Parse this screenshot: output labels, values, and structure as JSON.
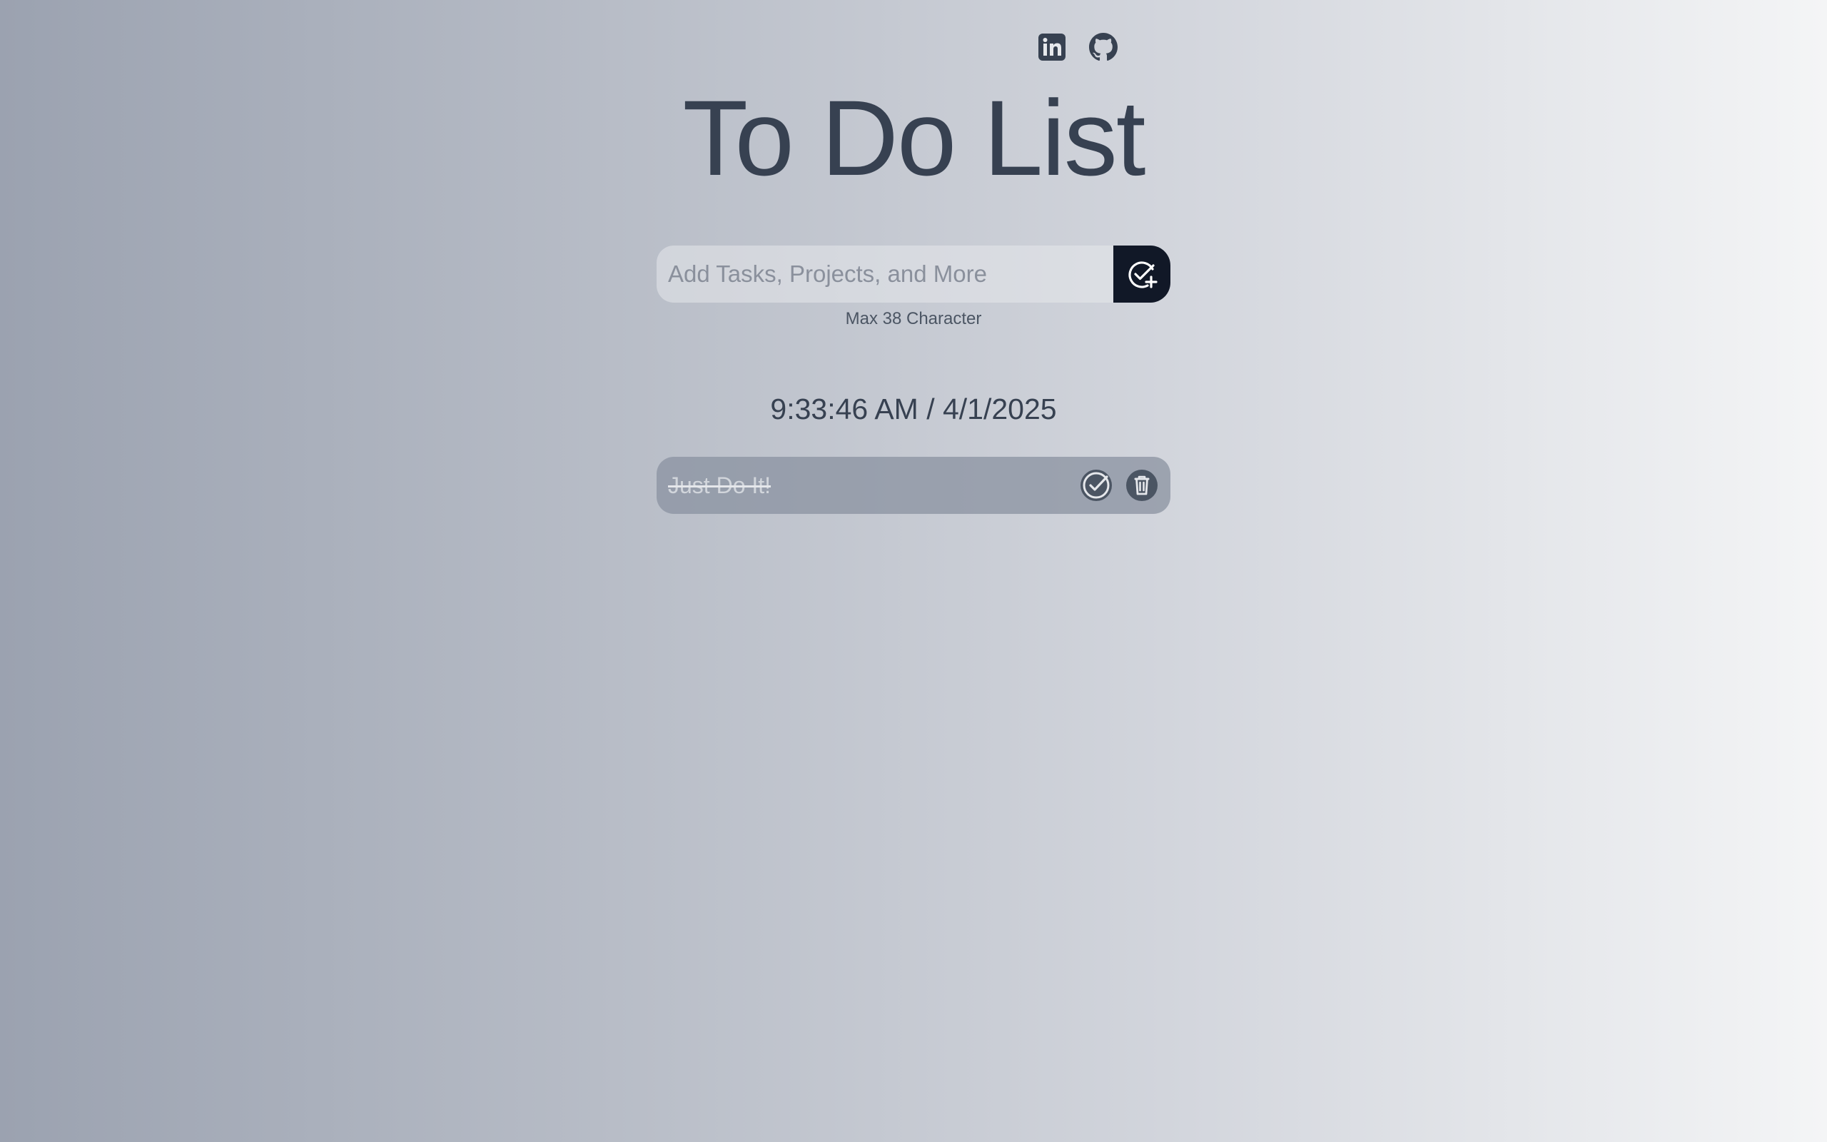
{
  "social": {
    "linkedin_icon": "linkedin-icon",
    "github_icon": "github-icon"
  },
  "title": "To Do List",
  "add_form": {
    "placeholder": "Add Tasks, Projects, and More",
    "value": "",
    "button_icon": "check-circle-plus-icon",
    "hint": "Max 38 Character"
  },
  "clock": "9:33:46 AM / 4/1/2025",
  "tasks": [
    {
      "text": "Just Do It!",
      "completed": true,
      "complete_icon": "check-circle-icon",
      "delete_icon": "trash-icon"
    }
  ],
  "colors": {
    "text": "#374151",
    "button_dark": "#111827",
    "task_bg": "#8a91a0"
  }
}
